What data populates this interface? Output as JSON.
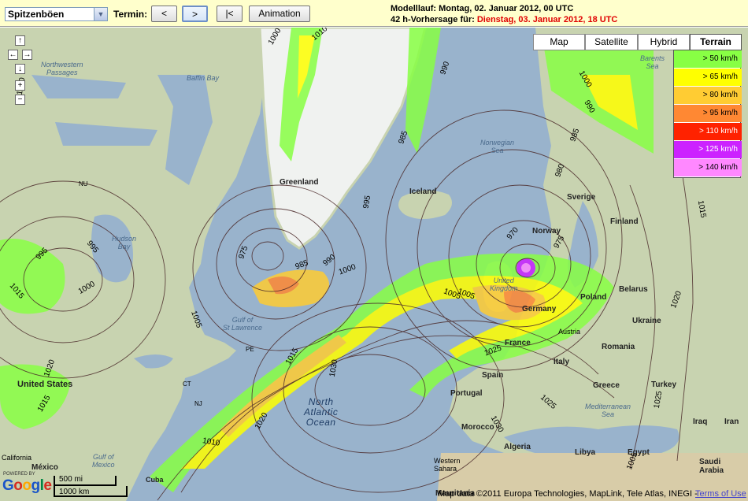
{
  "toolbar": {
    "product_select": "Spitzenböen",
    "termin_label": "Termin:",
    "prev_label": "<",
    "next_label": ">",
    "first_label": "|<",
    "animation_label": "Animation"
  },
  "info": {
    "model_run": "Modelllauf: Montag, 02. Januar 2012, 00 UTC",
    "forecast_prefix": "42 h-Vorhersage für: ",
    "forecast_time": "Dienstag, 03. Januar 2012, 18 UTC"
  },
  "map_types": [
    "Map",
    "Satellite",
    "Hybrid",
    "Terrain"
  ],
  "active_map_type": "Terrain",
  "legend": [
    {
      "label": "> 50 km/h",
      "color": "#88ff44"
    },
    {
      "label": "> 65 km/h",
      "color": "#ffff00"
    },
    {
      "label": "> 80 km/h",
      "color": "#ffcc33"
    },
    {
      "label": "> 95 km/h",
      "color": "#ff8833"
    },
    {
      "label": "> 110 km/h",
      "color": "#ff2200"
    },
    {
      "label": "> 125 km/h",
      "color": "#cc22ff"
    },
    {
      "label": "> 140 km/h",
      "color": "#ff88ff"
    }
  ],
  "places": {
    "northwest_passages": "Northwestern\nPassages",
    "baffin_bay": "Baffin Bay",
    "greenland": "Greenland",
    "iceland": "Iceland",
    "norwegian_sea": "Norwegian\nSea",
    "barents_sea": "Barents\nSea",
    "norway": "Norway",
    "sverige": "Sverige",
    "finland": "Finland",
    "hudson_bay": "Hudson\nBay",
    "nu": "NU",
    "united_kingdom": "United\nKingdom",
    "belarus": "Belarus",
    "ukraine": "Ukraine",
    "germany": "Germany",
    "poland": "Poland",
    "austria": "Austria",
    "france": "France",
    "romania": "Romania",
    "italy": "Italy",
    "spain": "Spain",
    "portugal": "Portugal",
    "greece": "Greece",
    "turkey": "Turkey",
    "iraq": "Iraq",
    "iran": "Iran",
    "mediterranean_sea": "Mediterranean\nSea",
    "morocco": "Morocco",
    "algeria": "Algeria",
    "libya": "Libya",
    "egypt": "Egypt",
    "saudi_arabia": "Saudi\nArabia",
    "western_sahara": "Western\nSahara",
    "mauritania": "Mauritania",
    "united_states": "United States",
    "mexico": "México",
    "california": "California",
    "gulf_of_mexico": "Gulf of\nMexico",
    "cuba": "Cuba",
    "north_atlantic_ocean": "North\nAtlantic\nOcean",
    "gulf_of_st_lawrence": "Gulf of\nSt Lawrence",
    "pe": "PE",
    "ct": "CT",
    "nj": "NJ"
  },
  "isobars": [
    "1000",
    "1010",
    "990",
    "995",
    "985",
    "980",
    "975",
    "970",
    "985",
    "1015",
    "1005",
    "1000",
    "995",
    "1015",
    "1020",
    "1005",
    "1015",
    "1030",
    "1025",
    "1020",
    "1010",
    "1030",
    "975",
    "985",
    "990",
    "995",
    "1000",
    "1005",
    "1010",
    "1015",
    "1020",
    "1025",
    "1025",
    "1005",
    "1000",
    "990"
  ],
  "footer": {
    "powered_by": "POWERED BY",
    "google": "Google",
    "scale_mi": "500 mi",
    "scale_km": "1000 km",
    "copyright": "Map data ©2011 Europa Technologies, MapLink, Tele Atlas, INEGI -",
    "terms": "Terms of Use"
  }
}
